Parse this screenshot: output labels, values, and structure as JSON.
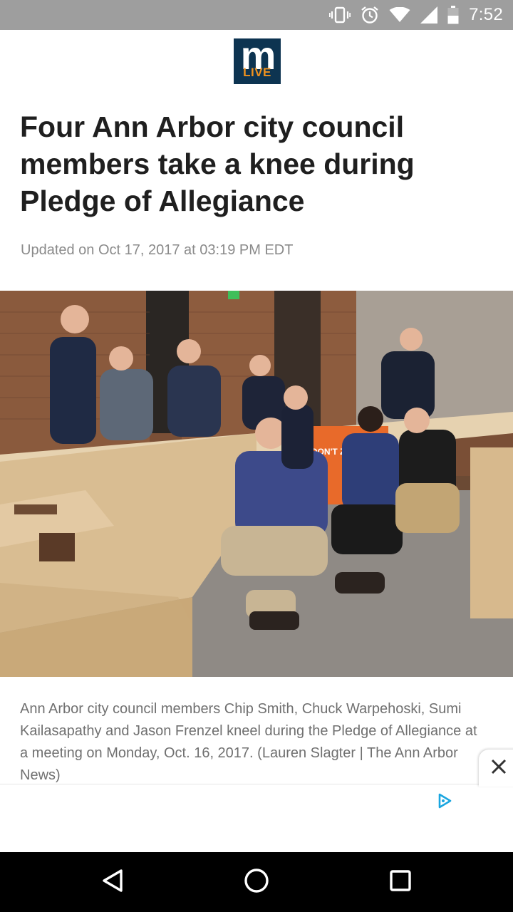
{
  "status_bar": {
    "time": "7:52",
    "icons": [
      "vibrate-icon",
      "alarm-icon",
      "wifi-icon",
      "signal-icon",
      "battery-icon"
    ]
  },
  "header": {
    "logo_main": "m",
    "logo_sub": "LIVE",
    "colors": {
      "logo_bg": "#0d3451",
      "logo_accent": "#f0921e"
    }
  },
  "article": {
    "headline": "Four Ann Arbor city council members take a knee during Pledge of Allegiance",
    "updated": "Updated on Oct 17, 2017 at 03:19 PM EDT",
    "photo_sign_text": "DON'T ZONE OUT!",
    "caption": "Ann Arbor city council members Chip Smith, Chuck Warpehoski, Sumi Kailasapathy and Jason Frenzel kneel during the Pledge of Allegiance at a meeting on Monday, Oct. 16, 2017. (Lauren Slagter | The Ann Arbor News)"
  },
  "ad": {
    "close_icon": "close-icon",
    "adchoices_icon": "adchoices-icon"
  },
  "nav_bar": {
    "buttons": [
      "back-icon",
      "home-icon",
      "recents-icon"
    ]
  }
}
